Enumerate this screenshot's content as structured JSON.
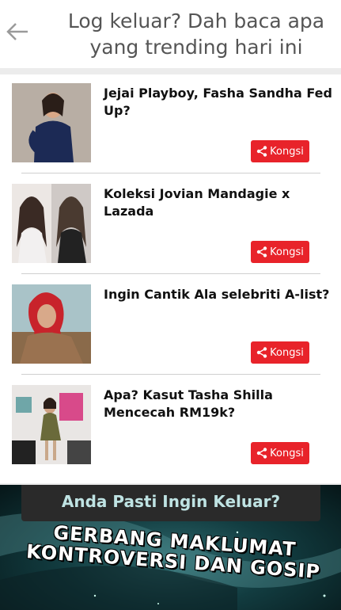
{
  "header": {
    "title": "Log keluar? Dah baca apa yang trending hari ini",
    "back_icon": "arrow-left-icon"
  },
  "colors": {
    "share_button": "#e8232a",
    "header_text": "#555555",
    "banner_accent": "#2f6a6e"
  },
  "items": [
    {
      "title": "Jejai Playboy, Fasha Sandha Fed Up?",
      "share_label": "Kongsi",
      "thumbnail": "woman-in-dark-outfit"
    },
    {
      "title": "Koleksi Jovian Mandagie x Lazada",
      "share_label": "Kongsi",
      "thumbnail": "two-models-portrait"
    },
    {
      "title": "Ingin Cantik Ala selebriti A-list?",
      "share_label": "Kongsi",
      "thumbnail": "woman-with-red-headscarf"
    },
    {
      "title": "Apa? Kasut Tasha Shilla Mencecah RM19k?",
      "share_label": "Kongsi",
      "thumbnail": "woman-at-event-backdrop"
    }
  ],
  "exit_prompt": "Anda Pasti Ingin Keluar?",
  "banner_text": "GERBANG MAKLUMAT KONTROVERSI DAN GOSIP"
}
